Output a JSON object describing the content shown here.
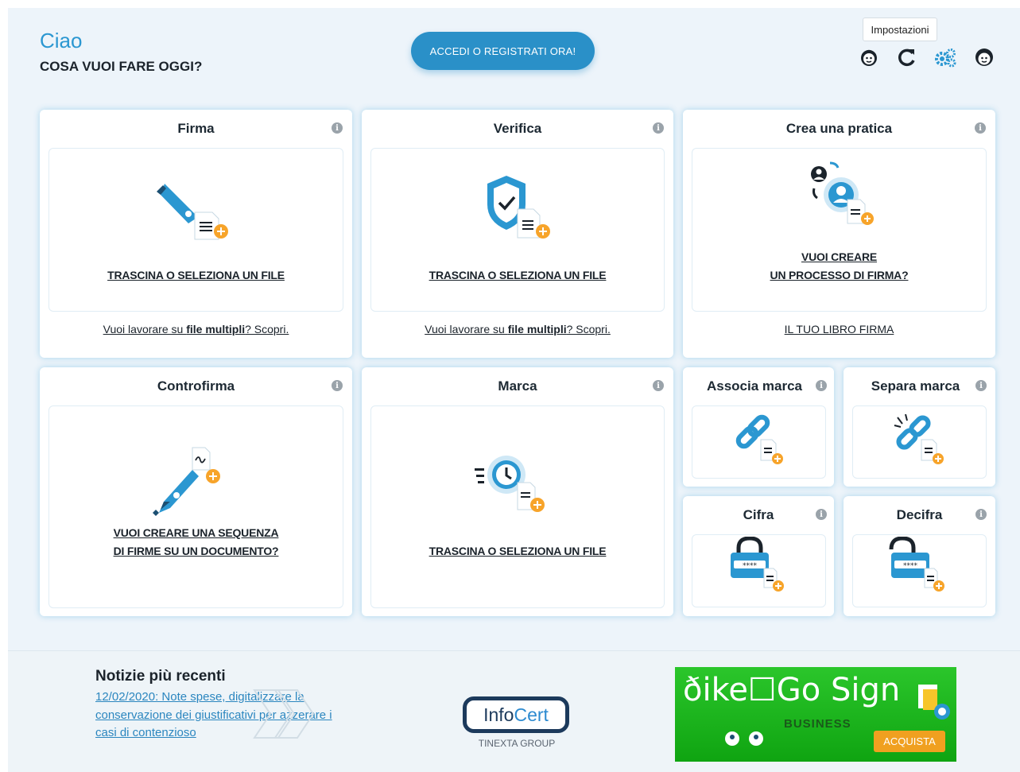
{
  "header": {
    "greeting": "Ciao",
    "question": "COSA VUOI FARE OGGI?",
    "login_button": "ACCEDI O REGISTRATI ORA!",
    "tooltip": "Impostazioni"
  },
  "cards": {
    "firma": {
      "title": "Firma",
      "dropzone": "TRASCINA O SELEZIONA UN FILE",
      "footer_pre": "Vuoi lavorare su ",
      "footer_bold": "file multipli",
      "footer_post": "? Scopri."
    },
    "verifica": {
      "title": "Verifica",
      "dropzone": "TRASCINA O SELEZIONA UN FILE",
      "footer_pre": "Vuoi lavorare su ",
      "footer_bold": "file multipli",
      "footer_post": "? Scopri."
    },
    "pratica": {
      "title": "Crea una pratica",
      "dropzone_line1": "VUOI CREARE",
      "dropzone_line2": "UN PROCESSO DI FIRMA?",
      "footer": "IL TUO LIBRO FIRMA"
    },
    "controfirma": {
      "title": "Controfirma",
      "dropzone_line1": "VUOI CREARE UNA SEQUENZA",
      "dropzone_line2": "DI FIRME SU UN DOCUMENTO?"
    },
    "marca": {
      "title": "Marca",
      "dropzone": "TRASCINA O SELEZIONA UN FILE"
    },
    "associa": {
      "title": "Associa marca"
    },
    "separa": {
      "title": "Separa marca"
    },
    "cifra": {
      "title": "Cifra"
    },
    "decifra": {
      "title": "Decifra"
    }
  },
  "footer": {
    "news_title": "Notizie più recenti",
    "news_link": "12/02/2020: Note spese, digitalizzare la conservazione dei giustificativi per azzerare i casi di contenzioso",
    "logo_text_a": "Info",
    "logo_text_b": "Cert",
    "logo_tagline": "TINEXTA GROUP",
    "banner_text": "ðike☐Go Sign",
    "banner_business": "BUSINESS",
    "banner_button": "ACQUISTA"
  },
  "icons": {
    "info": "i",
    "accent_color": "#2b97d1",
    "badge_color": "#f7a42a"
  }
}
